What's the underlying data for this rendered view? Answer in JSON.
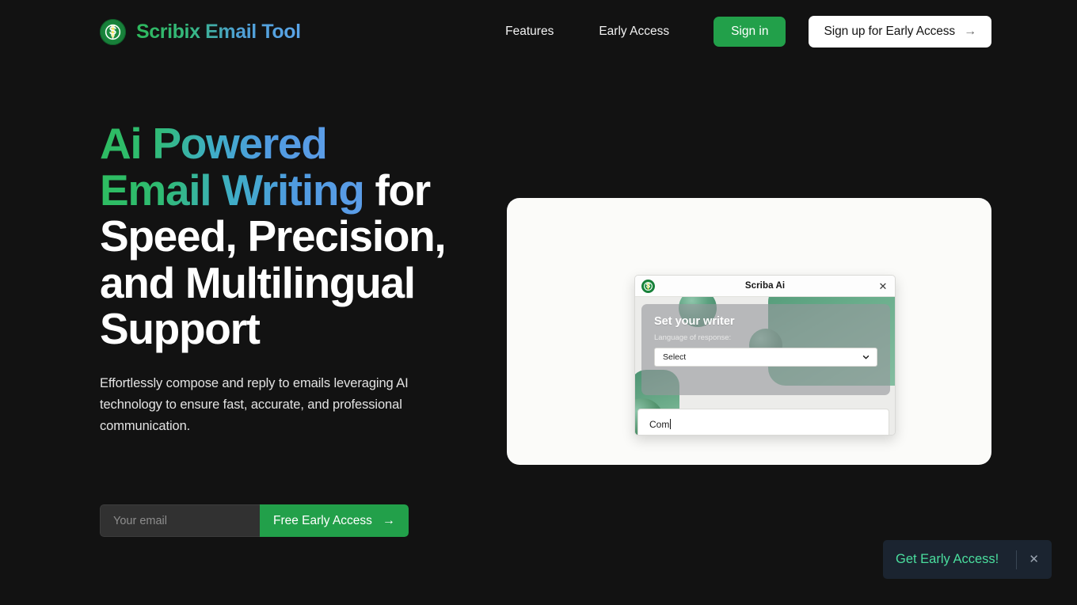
{
  "brand": {
    "name": "Scribix Email Tool",
    "logo_icon": "dollar-pencil-icon"
  },
  "nav": {
    "features_label": "Features",
    "early_access_label": "Early Access",
    "signin_label": "Sign in",
    "signup_label": "Sign up for Early Access",
    "signup_arrow": "→"
  },
  "hero": {
    "headline_gradient_line1": "Ai Powered",
    "headline_gradient_line2": "Email Writing",
    "headline_rest": " for Speed, Precision, and Multilingual Support",
    "subhead": "Effortlessly compose and reply to emails leveraging AI technology to ensure fast, accurate, and professional communication."
  },
  "signup_form": {
    "email_placeholder": "Your email",
    "email_value": "",
    "submit_label": "Free Early Access",
    "submit_arrow": "→"
  },
  "demo": {
    "popup": {
      "title": "Scriba Ai",
      "logo_icon": "dollar-pencil-icon",
      "close_icon": "✕",
      "panel_heading": "Set your writer",
      "language_label": "Language of response:",
      "select_value": "Select",
      "select_options": [
        "Select"
      ],
      "chevron_icon": "chevron-down-icon",
      "prompt_value": "Com"
    }
  },
  "toast": {
    "text": "Get Early Access!",
    "close_icon": "✕"
  },
  "colors": {
    "page_background": "#121212",
    "accent_green": "#22a04a",
    "brand_gradient_start": "#2eb85c",
    "brand_gradient_end": "#5aa4e8",
    "toast_background": "#1b2430",
    "toast_text": "#4ade9e",
    "card_background": "#fbfbf9"
  }
}
